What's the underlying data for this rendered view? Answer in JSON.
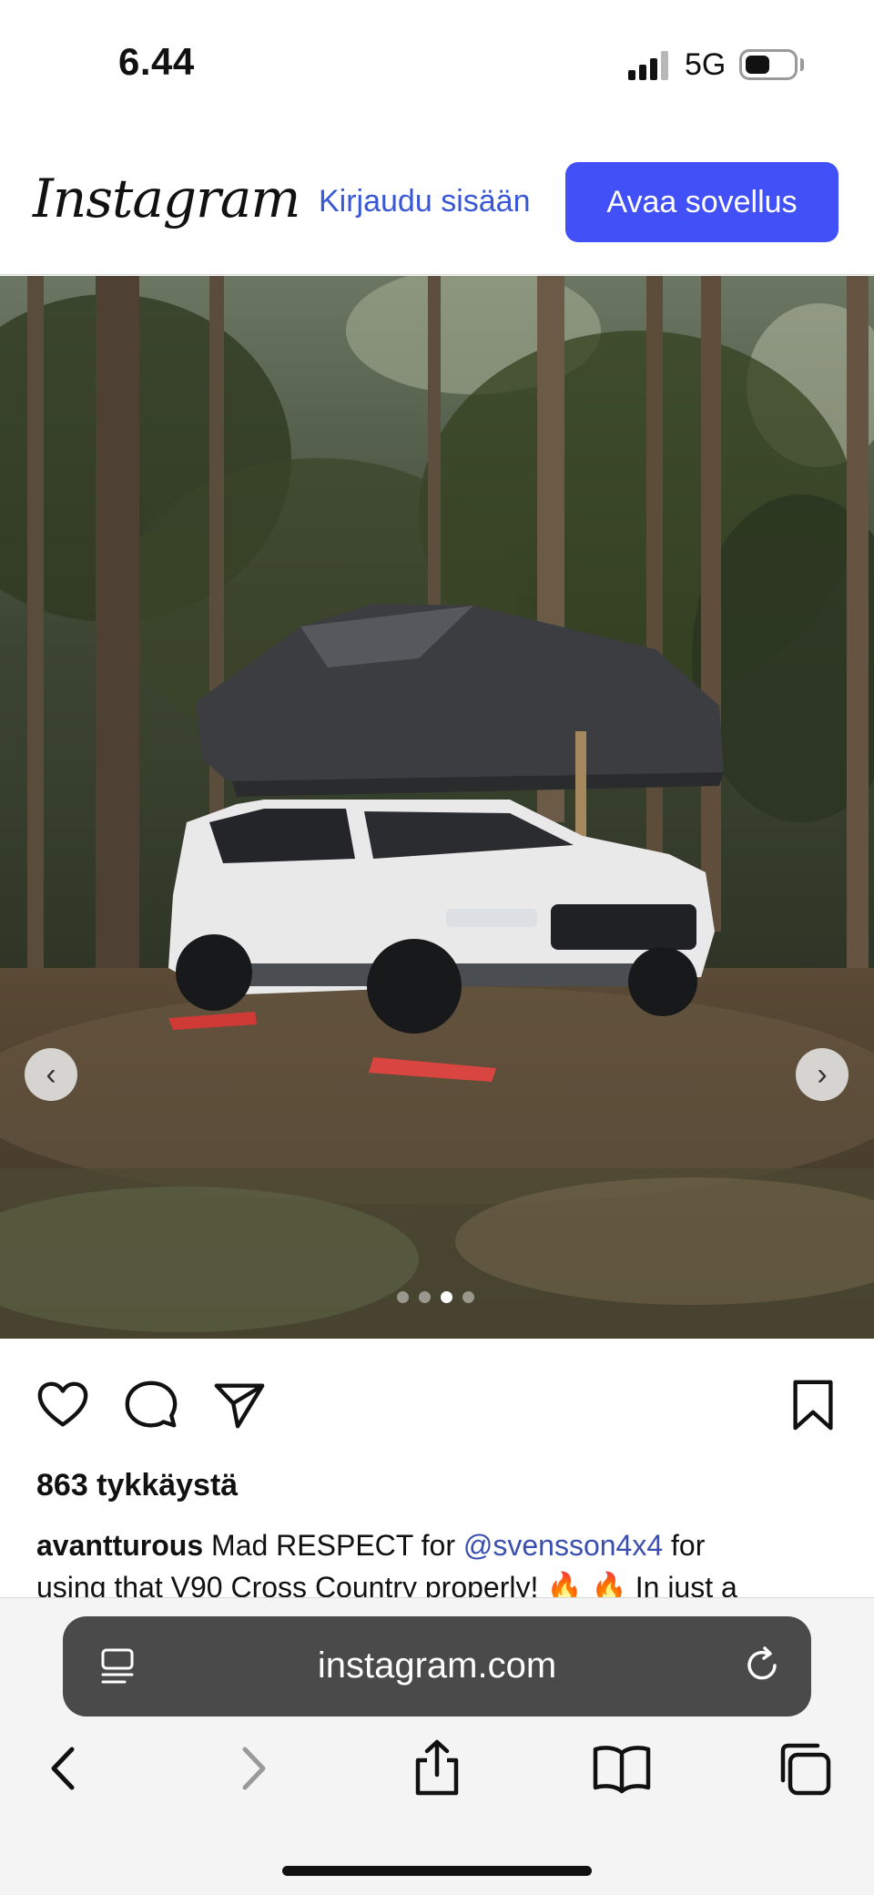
{
  "status_bar": {
    "time": "6.44",
    "network": "5G"
  },
  "header": {
    "logo": "Instagram",
    "login_label": "Kirjaudu sisään",
    "open_app_label": "Avaa sovellus",
    "accent_color": "#4150f7"
  },
  "post": {
    "image_description_icon": "photo",
    "carousel": {
      "slide_count": 4,
      "active_index": 2,
      "prev_icon": "chevron-left-icon",
      "next_icon": "chevron-right-icon"
    },
    "actions": {
      "like_icon": "heart-icon",
      "comment_icon": "comment-icon",
      "share_icon": "send-icon",
      "save_icon": "bookmark-icon"
    },
    "likes_label": "863 tykkäystä",
    "caption": {
      "username": "avantturous",
      "text_before_mention": " Mad RESPECT for ",
      "mention": "@svensson4x4",
      "text_after_mention": " for",
      "line2": "using that V90 Cross Country properly! 🔥 🔥 In just a"
    }
  },
  "browser": {
    "url": "instagram.com",
    "left_icon": "reader-mode-icon",
    "right_icon": "reload-icon",
    "toolbar": [
      "back-icon",
      "forward-icon",
      "share-icon",
      "bookmarks-icon",
      "tabs-icon"
    ]
  }
}
